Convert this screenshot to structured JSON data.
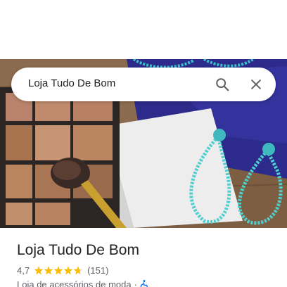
{
  "search": {
    "query": "Loja Tudo De Bom",
    "search_icon": "search-icon",
    "close_icon": "close-icon"
  },
  "hero": {
    "image_subject": "eyeshadow palette, makeup brush, turquoise crystal earrings on wooden table"
  },
  "place": {
    "name": "Loja Tudo De Bom",
    "rating": "4,7",
    "rating_fraction": 0.94,
    "review_count": "(151)",
    "category": "Loja de acessórios de moda",
    "separator": "·",
    "accessibility_icon": "wheelchair-icon"
  },
  "colors": {
    "star": "#fbbc04",
    "star_empty": "#dadce0",
    "accessibility": "#1a73e8",
    "text_primary": "#202124",
    "text_secondary": "#5f6368"
  }
}
